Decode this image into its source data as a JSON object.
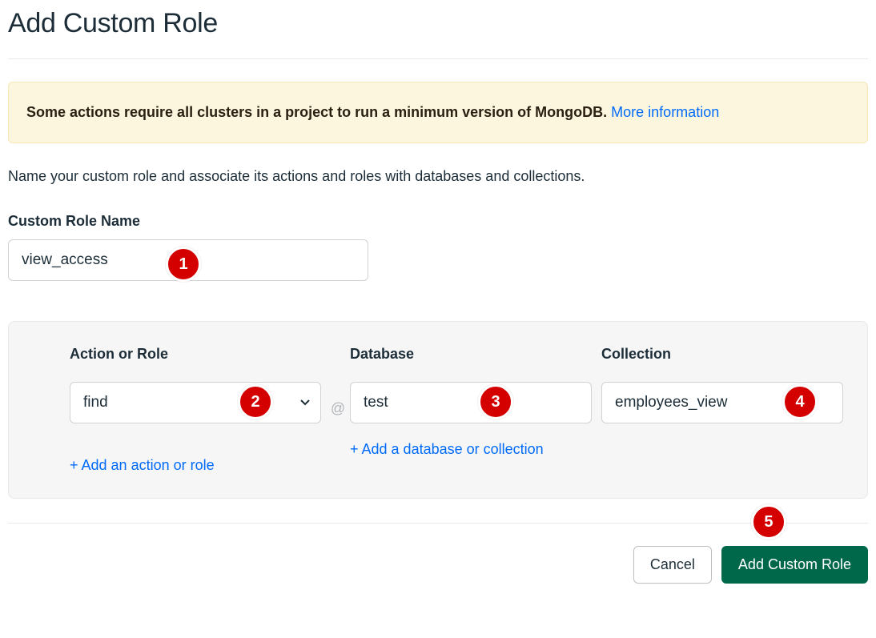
{
  "title": "Add Custom Role",
  "banner": {
    "bold_text": "Some actions require all clusters in a project to run a minimum version of MongoDB.",
    "link_text": "More information"
  },
  "description": "Name your custom role and associate its actions and roles with databases and collections.",
  "role_name": {
    "label": "Custom Role Name",
    "value": "view_access"
  },
  "columns": {
    "action": "Action or Role",
    "database": "Database",
    "collection": "Collection"
  },
  "at_symbol": "@",
  "row": {
    "action_value": "find",
    "database_value": "test",
    "collection_value": "employees_view"
  },
  "links": {
    "add_db_coll": "+ Add a database or collection",
    "add_action": "+ Add an action or role"
  },
  "buttons": {
    "cancel": "Cancel",
    "submit": "Add Custom Role"
  },
  "callouts": {
    "c1": "1",
    "c2": "2",
    "c3": "3",
    "c4": "4",
    "c5": "5"
  }
}
